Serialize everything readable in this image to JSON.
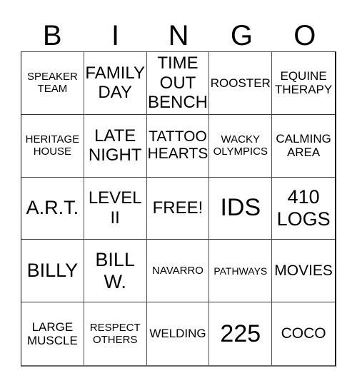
{
  "header": {
    "letters": [
      "B",
      "I",
      "N",
      "G",
      "O"
    ]
  },
  "card": {
    "rows": [
      [
        "SPEAKER\nTEAM",
        "FAMILY\nDAY",
        "TIME\nOUT\nBENCH",
        "ROOSTER",
        "EQUINE\nTHERAPY"
      ],
      [
        "HERITAGE\nHOUSE",
        "LATE\nNIGHT",
        "TATTOO\nHEARTS",
        "WACKY\nOLYMPICS",
        "CALMING\nAREA"
      ],
      [
        "A.R.T.",
        "LEVEL\nII",
        "FREE!",
        "IDS",
        "410\nLOGS"
      ],
      [
        "BILLY",
        "BILL\nW.",
        "NAVARRO",
        "PATHWAYS",
        "MOVIES"
      ],
      [
        "LARGE\nMUSCLE",
        "RESPECT\nOTHERS",
        "WELDING",
        "225",
        "COCO"
      ]
    ],
    "free_space": "FREE!"
  }
}
